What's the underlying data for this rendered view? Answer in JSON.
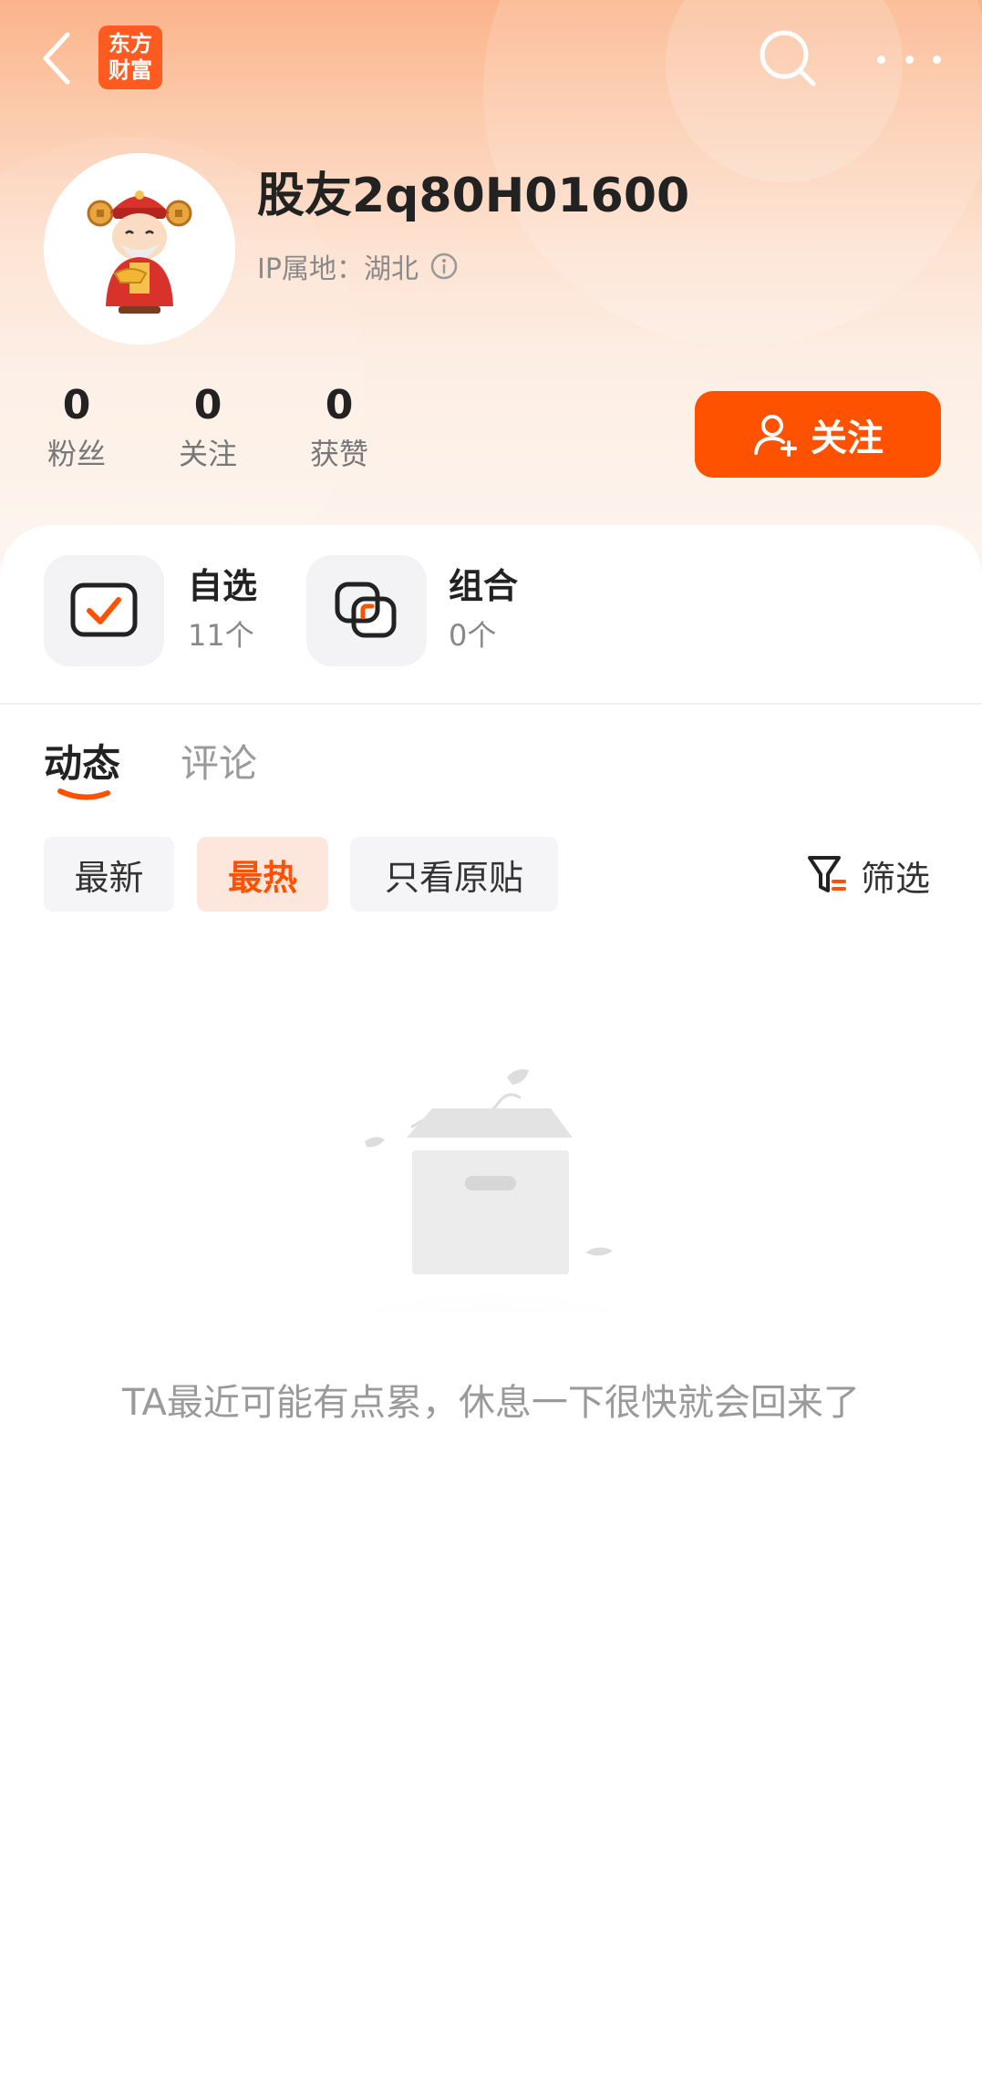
{
  "header": {
    "logo_line1": "东方",
    "logo_line2": "财富"
  },
  "profile": {
    "username": "股友2q80H01600",
    "ip_location": "IP属地：湖北"
  },
  "stats": [
    {
      "value": "0",
      "label": "粉丝"
    },
    {
      "value": "0",
      "label": "关注"
    },
    {
      "value": "0",
      "label": "获赞"
    }
  ],
  "follow_button": {
    "label": "关注"
  },
  "tiles": [
    {
      "title": "自选",
      "subtitle": "11个"
    },
    {
      "title": "组合",
      "subtitle": "0个"
    }
  ],
  "tabs": [
    {
      "label": "动态",
      "active": true
    },
    {
      "label": "评论",
      "active": false
    }
  ],
  "filters": [
    {
      "label": "最新",
      "active": false
    },
    {
      "label": "最热",
      "active": true
    },
    {
      "label": "只看原贴",
      "active": false
    }
  ],
  "filter_button": {
    "label": "筛选"
  },
  "empty_state": {
    "message": "TA最近可能有点累，休息一下很快就会回来了"
  },
  "colors": {
    "accent": "#ff5200",
    "chip_active_bg": "#fde7dc"
  }
}
